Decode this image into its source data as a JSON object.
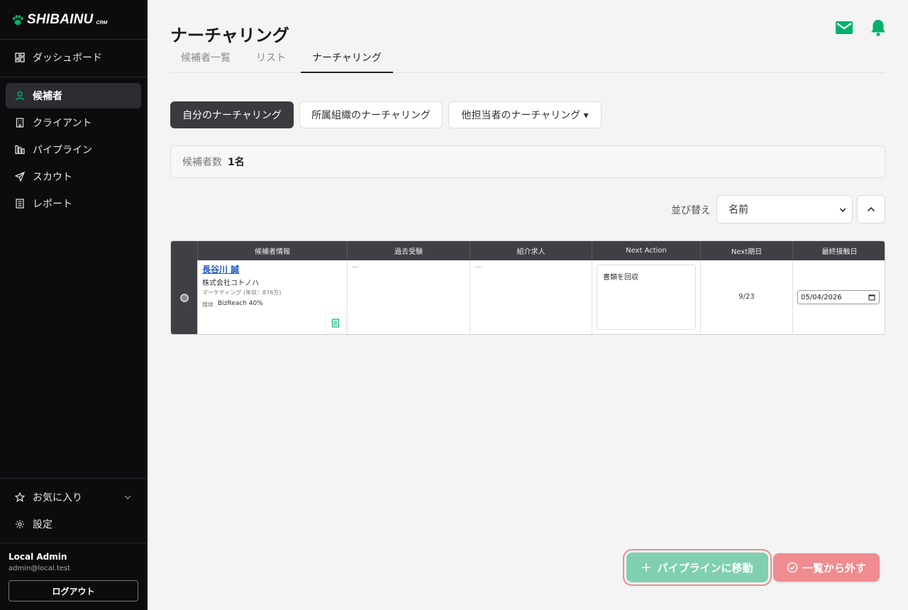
{
  "app": {
    "brand": "SHIBAINU",
    "brand_suffix": "CRM"
  },
  "sidebar": {
    "items": [
      {
        "label": "ダッシュボード",
        "icon": "dashboard-icon",
        "active": false
      },
      {
        "label": "候補者",
        "icon": "user-icon",
        "active": true
      },
      {
        "label": "クライアント",
        "icon": "building-icon",
        "active": false
      },
      {
        "label": "パイプライン",
        "icon": "pipeline-icon",
        "active": false
      },
      {
        "label": "スカウト",
        "icon": "send-icon",
        "active": false
      },
      {
        "label": "レポート",
        "icon": "report-icon",
        "active": false
      }
    ],
    "favorites_label": "お気に入り",
    "settings_label": "設定",
    "user": {
      "name": "Local Admin",
      "email": "admin@local.test"
    },
    "logout_label": "ログアウト"
  },
  "header": {
    "title": "ナーチャリング",
    "icons": [
      "mail-icon",
      "bell-icon"
    ],
    "accent_color": "#00b26b"
  },
  "tabs": [
    {
      "label": "候補者一覧",
      "active": false
    },
    {
      "label": "リスト",
      "active": false
    },
    {
      "label": "ナーチャリング",
      "active": true
    }
  ],
  "filters": {
    "mine": "自分のナーチャリング",
    "org": "所属組織のナーチャリング",
    "others": "他担当者のナーチャリング ▾"
  },
  "summary": {
    "label": "候補者数",
    "value": "1名"
  },
  "sort": {
    "label": "並び替え",
    "selected": "名前"
  },
  "table": {
    "headers": [
      "",
      "候補者情報",
      "過去受験",
      "紹介求人",
      "Next Action",
      "Next期日",
      "最終接触日"
    ],
    "rows": [
      {
        "name": "長谷川 誠",
        "company": "株式会社コトノハ",
        "job": "マーケティング (年収：876万)",
        "media_label": "媒体",
        "media": "BizReach 40%",
        "past_exam": "—",
        "referral": "—",
        "next_action": "書類を回収",
        "next_date": "9/23",
        "last_contact": "05/04/2026"
      }
    ]
  },
  "actions": {
    "move_pipeline": "パイプラインに移動",
    "remove": "一覧から外す",
    "pipeline_color": "#7fcfb0",
    "remove_color": "#f08b8f"
  }
}
